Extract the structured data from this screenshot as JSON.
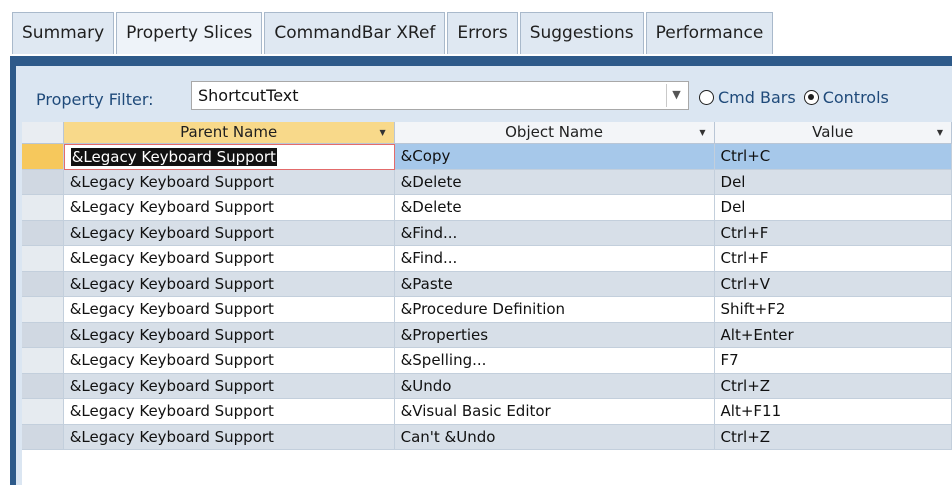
{
  "tabs": [
    {
      "label": "Summary"
    },
    {
      "label": "Property Slices"
    },
    {
      "label": "CommandBar XRef"
    },
    {
      "label": "Errors"
    },
    {
      "label": "Suggestions"
    },
    {
      "label": "Performance"
    }
  ],
  "filter": {
    "label": "Property Filter:",
    "value": "ShortcutText",
    "dropdown_icon": "chevron-down-icon",
    "radios": [
      {
        "label": "Cmd Bars",
        "selected": false
      },
      {
        "label": "Controls",
        "selected": true
      }
    ]
  },
  "grid": {
    "columns": [
      "Parent Name",
      "Object Name",
      "Value"
    ],
    "rows": [
      {
        "parent": "&Legacy Keyboard Support",
        "object": "&Copy",
        "value": "Ctrl+C"
      },
      {
        "parent": "&Legacy Keyboard Support",
        "object": "&Delete",
        "value": "Del"
      },
      {
        "parent": "&Legacy Keyboard Support",
        "object": "&Delete",
        "value": "Del"
      },
      {
        "parent": "&Legacy Keyboard Support",
        "object": "&Find...",
        "value": "Ctrl+F"
      },
      {
        "parent": "&Legacy Keyboard Support",
        "object": "&Find...",
        "value": "Ctrl+F"
      },
      {
        "parent": "&Legacy Keyboard Support",
        "object": "&Paste",
        "value": "Ctrl+V"
      },
      {
        "parent": "&Legacy Keyboard Support",
        "object": "&Procedure Definition",
        "value": "Shift+F2"
      },
      {
        "parent": "&Legacy Keyboard Support",
        "object": "&Properties",
        "value": "Alt+Enter"
      },
      {
        "parent": "&Legacy Keyboard Support",
        "object": "&Spelling...",
        "value": "F7"
      },
      {
        "parent": "&Legacy Keyboard Support",
        "object": "&Undo",
        "value": "Ctrl+Z"
      },
      {
        "parent": "&Legacy Keyboard Support",
        "object": "&Visual Basic Editor",
        "value": "Alt+F11"
      },
      {
        "parent": "&Legacy Keyboard Support",
        "object": "Can't &Undo",
        "value": "Ctrl+Z"
      }
    ]
  }
}
